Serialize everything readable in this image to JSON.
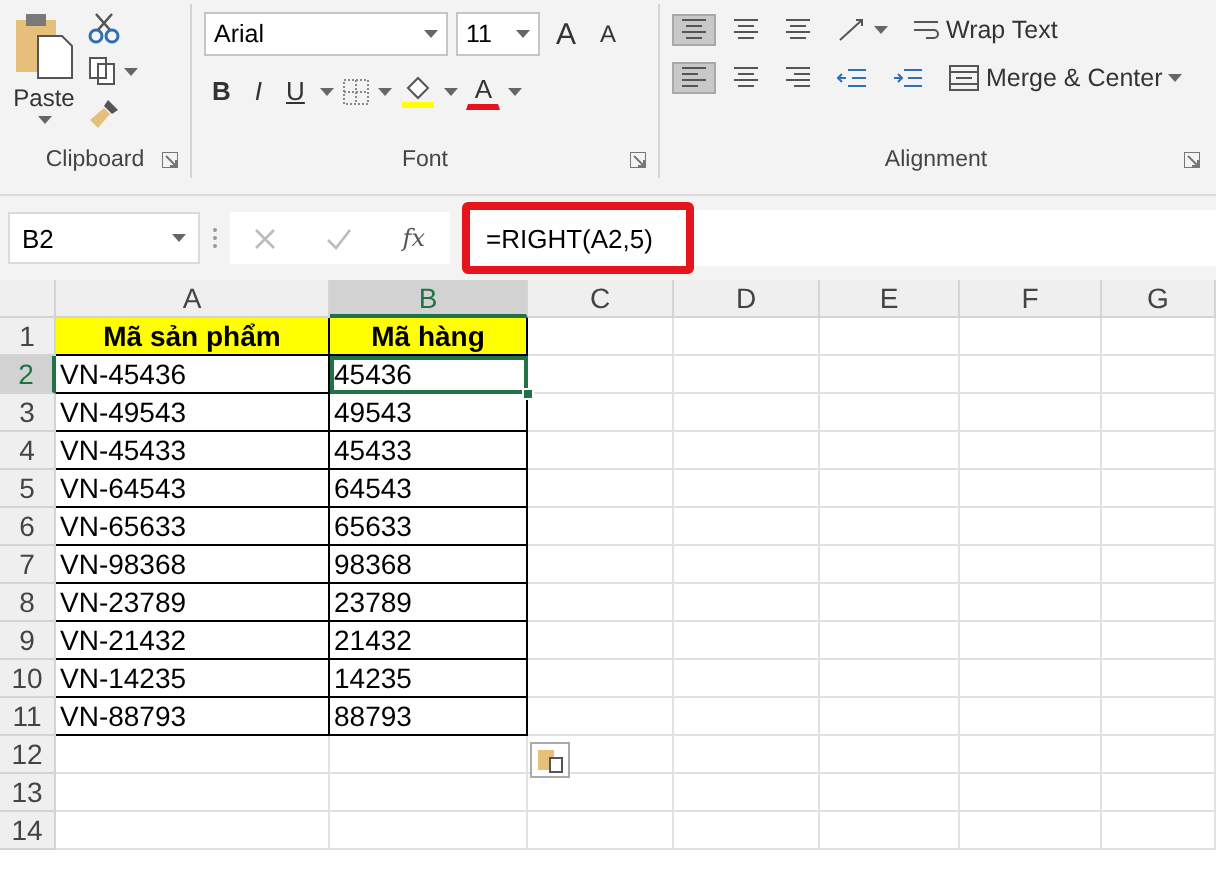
{
  "ribbon": {
    "clipboard": {
      "paste_label": "Paste",
      "group_label": "Clipboard"
    },
    "font": {
      "font_name": "Arial",
      "font_size": "11",
      "grow": "A",
      "shrink": "A",
      "bold": "B",
      "italic": "I",
      "underline": "U",
      "font_color": "A",
      "group_label": "Font"
    },
    "alignment": {
      "wrap_text": "Wrap Text",
      "merge_center": "Merge & Center",
      "group_label": "Alignment",
      "top_align_selected": true,
      "left_align_selected": true
    }
  },
  "formula_bar": {
    "name_box": "B2",
    "fx": "fx",
    "formula": "=RIGHT(A2,5)",
    "highlighted": true
  },
  "columns": [
    {
      "label": "A",
      "selected": false
    },
    {
      "label": "B",
      "selected": true
    },
    {
      "label": "C",
      "selected": false
    },
    {
      "label": "D",
      "selected": false
    },
    {
      "label": "E",
      "selected": false
    },
    {
      "label": "F",
      "selected": false
    },
    {
      "label": "G",
      "selected": false
    }
  ],
  "rows": [
    {
      "number": "1",
      "selected": false,
      "kind": "header",
      "cells": [
        {
          "text": "Mã sản phẩm",
          "active": false
        },
        {
          "text": "Mã hàng",
          "active": false
        }
      ]
    },
    {
      "number": "2",
      "selected": true,
      "kind": "data",
      "cells": [
        {
          "text": "VN-45436",
          "active": false
        },
        {
          "text": "45436",
          "active": true
        }
      ]
    },
    {
      "number": "3",
      "selected": false,
      "kind": "data",
      "cells": [
        {
          "text": "VN-49543",
          "active": false
        },
        {
          "text": "49543",
          "active": false
        }
      ]
    },
    {
      "number": "4",
      "selected": false,
      "kind": "data",
      "cells": [
        {
          "text": "VN-45433",
          "active": false
        },
        {
          "text": "45433",
          "active": false
        }
      ]
    },
    {
      "number": "5",
      "selected": false,
      "kind": "data",
      "cells": [
        {
          "text": "VN-64543",
          "active": false
        },
        {
          "text": "64543",
          "active": false
        }
      ]
    },
    {
      "number": "6",
      "selected": false,
      "kind": "data",
      "cells": [
        {
          "text": "VN-65633",
          "active": false
        },
        {
          "text": "65633",
          "active": false
        }
      ]
    },
    {
      "number": "7",
      "selected": false,
      "kind": "data",
      "cells": [
        {
          "text": "VN-98368",
          "active": false
        },
        {
          "text": "98368",
          "active": false
        }
      ]
    },
    {
      "number": "8",
      "selected": false,
      "kind": "data",
      "cells": [
        {
          "text": "VN-23789",
          "active": false
        },
        {
          "text": "23789",
          "active": false
        }
      ]
    },
    {
      "number": "9",
      "selected": false,
      "kind": "data",
      "cells": [
        {
          "text": "VN-21432",
          "active": false
        },
        {
          "text": "21432",
          "active": false
        }
      ]
    },
    {
      "number": "10",
      "selected": false,
      "kind": "data",
      "cells": [
        {
          "text": "VN-14235",
          "active": false
        },
        {
          "text": "14235",
          "active": false
        }
      ]
    },
    {
      "number": "11",
      "selected": false,
      "kind": "data",
      "cells": [
        {
          "text": "VN-88793",
          "active": false
        },
        {
          "text": "88793",
          "active": false
        }
      ]
    },
    {
      "number": "12",
      "selected": false,
      "kind": "empty",
      "cells": []
    },
    {
      "number": "13",
      "selected": false,
      "kind": "empty",
      "cells": []
    },
    {
      "number": "14",
      "selected": false,
      "kind": "empty",
      "cells": []
    }
  ]
}
